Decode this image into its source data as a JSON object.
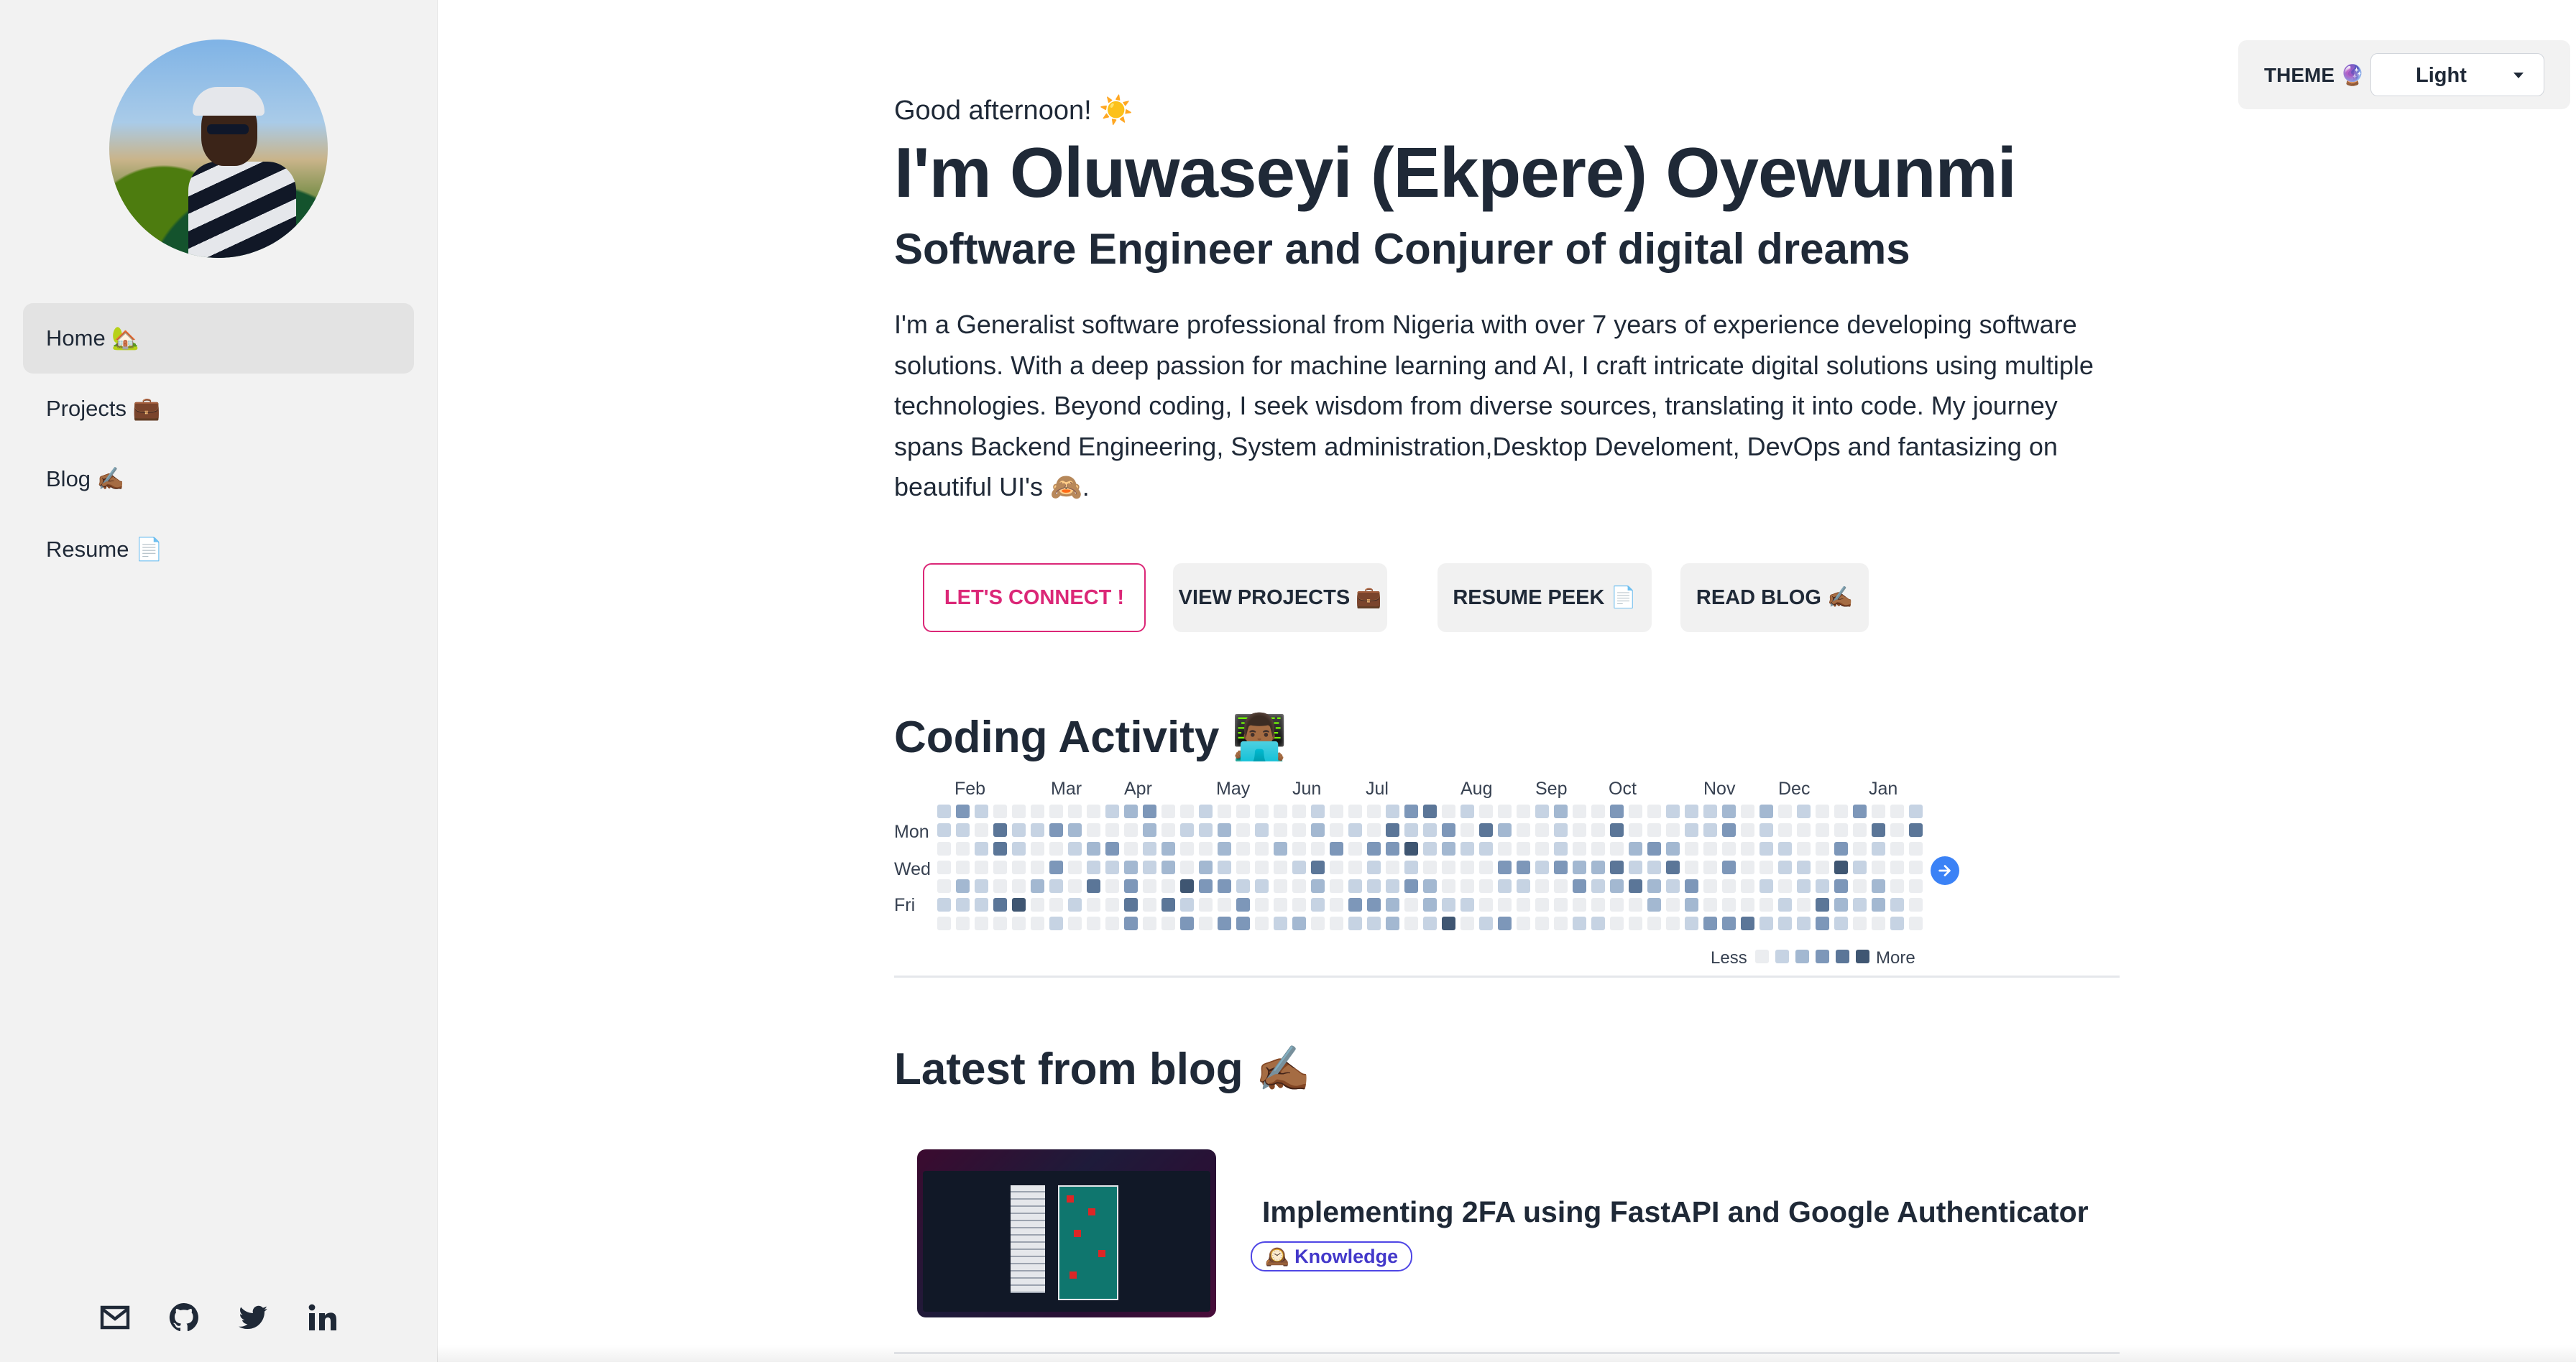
{
  "sidebar": {
    "items": [
      {
        "label": "Home 🏡",
        "active": true
      },
      {
        "label": "Projects 💼",
        "active": false
      },
      {
        "label": "Blog ✍🏾",
        "active": false
      },
      {
        "label": "Resume 📄",
        "active": false
      }
    ],
    "socials": [
      "mail-icon",
      "github-icon",
      "twitter-icon",
      "linkedin-icon"
    ]
  },
  "theme": {
    "label": "THEME 🔮",
    "value": "Light"
  },
  "hero": {
    "greeting": "Good afternoon! ☀️",
    "name": "I'm Oluwaseyi (Ekpere) Oyewunmi",
    "subtitle": "Software Engineer and Conjurer of digital dreams",
    "bio": "I'm a Generalist software professional from Nigeria with over 7 years of experience developing software solutions. With a deep passion for machine learning and AI, I craft intricate digital solutions using multiple technologies. Beyond coding, I seek wisdom from diverse sources, translating it into code. My journey spans Backend Engineering, System administration,Desktop Develoment, DevOps and fantasizing on beautiful UI's 🙈."
  },
  "buttons": {
    "connect": "LET'S CONNECT !",
    "projects": "VIEW PROJECTS 💼",
    "resume": "RESUME PEEK 📄",
    "blog": "READ BLOG ✍🏾"
  },
  "activity": {
    "title": "Coding Activity 👨🏾‍💻",
    "months": [
      "Feb",
      "Mar",
      "Apr",
      "May",
      "Jun",
      "Jul",
      "Aug",
      "Sep",
      "Oct",
      "Nov",
      "Dec",
      "Jan"
    ],
    "days": [
      "Mon",
      "Wed",
      "Fri"
    ],
    "legend_less": "Less",
    "legend_more": "More",
    "colors": [
      "#ebedf0",
      "#c6d3e3",
      "#a3b8d1",
      "#7d97b9",
      "#5b7698",
      "#3f5672",
      "#111111"
    ]
  },
  "blog": {
    "title": "Latest from blog ✍🏾",
    "post_title": "Implementing 2FA using FastAPI and Google Authenticator",
    "badge": "🕰️ Knowledge"
  }
}
